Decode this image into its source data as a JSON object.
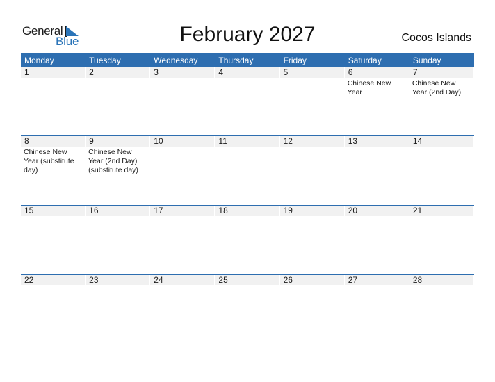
{
  "logo": {
    "general": "General",
    "blue": "Blue"
  },
  "title": "February 2027",
  "region": "Cocos Islands",
  "colors": {
    "header_bg": "#2e6eb0",
    "day_bg": "#f1f1f1",
    "brand_blue": "#2a74b8"
  },
  "weekdays": [
    "Monday",
    "Tuesday",
    "Wednesday",
    "Thursday",
    "Friday",
    "Saturday",
    "Sunday"
  ],
  "weeks": [
    [
      {
        "day": "1",
        "event": ""
      },
      {
        "day": "2",
        "event": ""
      },
      {
        "day": "3",
        "event": ""
      },
      {
        "day": "4",
        "event": ""
      },
      {
        "day": "5",
        "event": ""
      },
      {
        "day": "6",
        "event": "Chinese New Year"
      },
      {
        "day": "7",
        "event": "Chinese New Year (2nd Day)"
      }
    ],
    [
      {
        "day": "8",
        "event": "Chinese New Year (substitute day)"
      },
      {
        "day": "9",
        "event": "Chinese New Year (2nd Day) (substitute day)"
      },
      {
        "day": "10",
        "event": ""
      },
      {
        "day": "11",
        "event": ""
      },
      {
        "day": "12",
        "event": ""
      },
      {
        "day": "13",
        "event": ""
      },
      {
        "day": "14",
        "event": ""
      }
    ],
    [
      {
        "day": "15",
        "event": ""
      },
      {
        "day": "16",
        "event": ""
      },
      {
        "day": "17",
        "event": ""
      },
      {
        "day": "18",
        "event": ""
      },
      {
        "day": "19",
        "event": ""
      },
      {
        "day": "20",
        "event": ""
      },
      {
        "day": "21",
        "event": ""
      }
    ],
    [
      {
        "day": "22",
        "event": ""
      },
      {
        "day": "23",
        "event": ""
      },
      {
        "day": "24",
        "event": ""
      },
      {
        "day": "25",
        "event": ""
      },
      {
        "day": "26",
        "event": ""
      },
      {
        "day": "27",
        "event": ""
      },
      {
        "day": "28",
        "event": ""
      }
    ]
  ]
}
